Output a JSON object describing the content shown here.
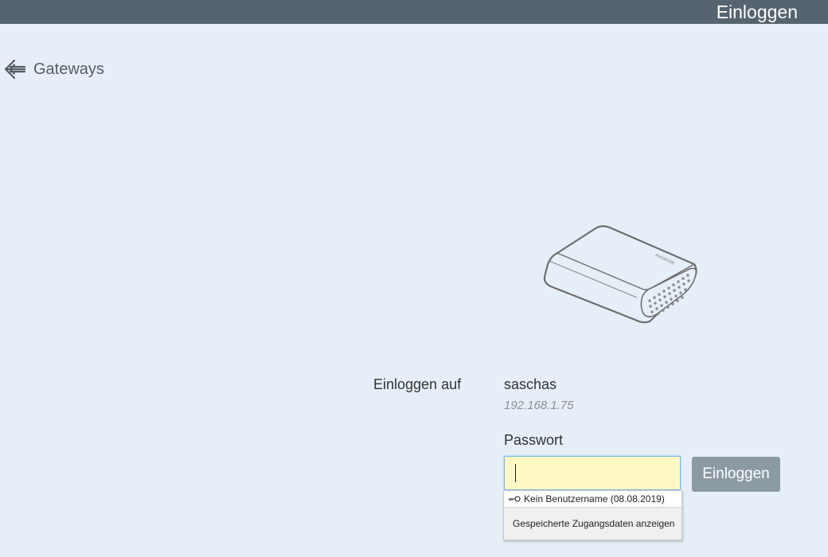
{
  "header": {
    "title": "Einloggen"
  },
  "nav": {
    "back_label": "Gateways",
    "back_icon": "arrow-left-icon"
  },
  "device": {
    "brand": "PHOSCON"
  },
  "login": {
    "login_on_label": "Einloggen auf",
    "gateway_name": "saschas",
    "gateway_ip": "192.168.1.75",
    "password_label": "Passwort",
    "password_value": "",
    "button_label": "Einloggen"
  },
  "autocomplete": {
    "item_icon": "key-icon",
    "item_label": "Kein Benutzername (08.08.2019)",
    "footer_label": "Gespeicherte Zugangsdaten anzeigen"
  },
  "colors": {
    "topbar": "#566470",
    "background": "#e6eff7",
    "button": "#8c9aa4",
    "input_background": "#fff8c4",
    "input_border": "#79b9e6"
  }
}
